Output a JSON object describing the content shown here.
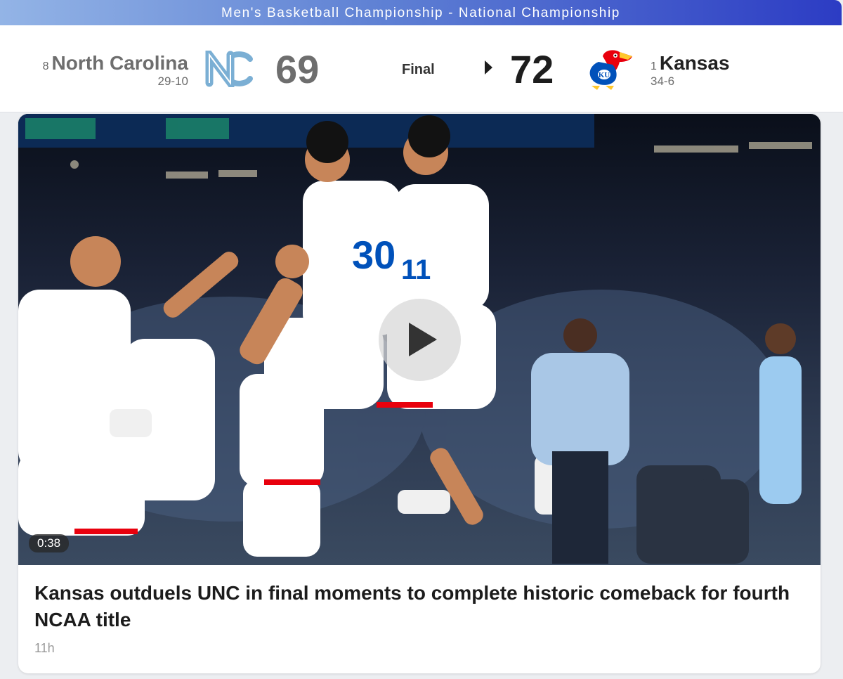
{
  "banner": {
    "title": "Men's Basketball Championship - National Championship"
  },
  "game": {
    "status": "Final",
    "home": {
      "seed": "8",
      "name": "North Carolina",
      "record": "29-10",
      "score": "69",
      "logo_icon": "unc-logo-icon",
      "color": "#7bafd4"
    },
    "away": {
      "seed": "1",
      "name": "Kansas",
      "record": "34-6",
      "score": "72",
      "logo_icon": "kansas-jayhawk-logo-icon",
      "color": "#0051ba",
      "winner": true
    }
  },
  "article": {
    "video_duration": "0:38",
    "headline": "Kansas outduels UNC in final moments to complete historic comeback for fourth NCAA title",
    "timestamp": "11h"
  }
}
